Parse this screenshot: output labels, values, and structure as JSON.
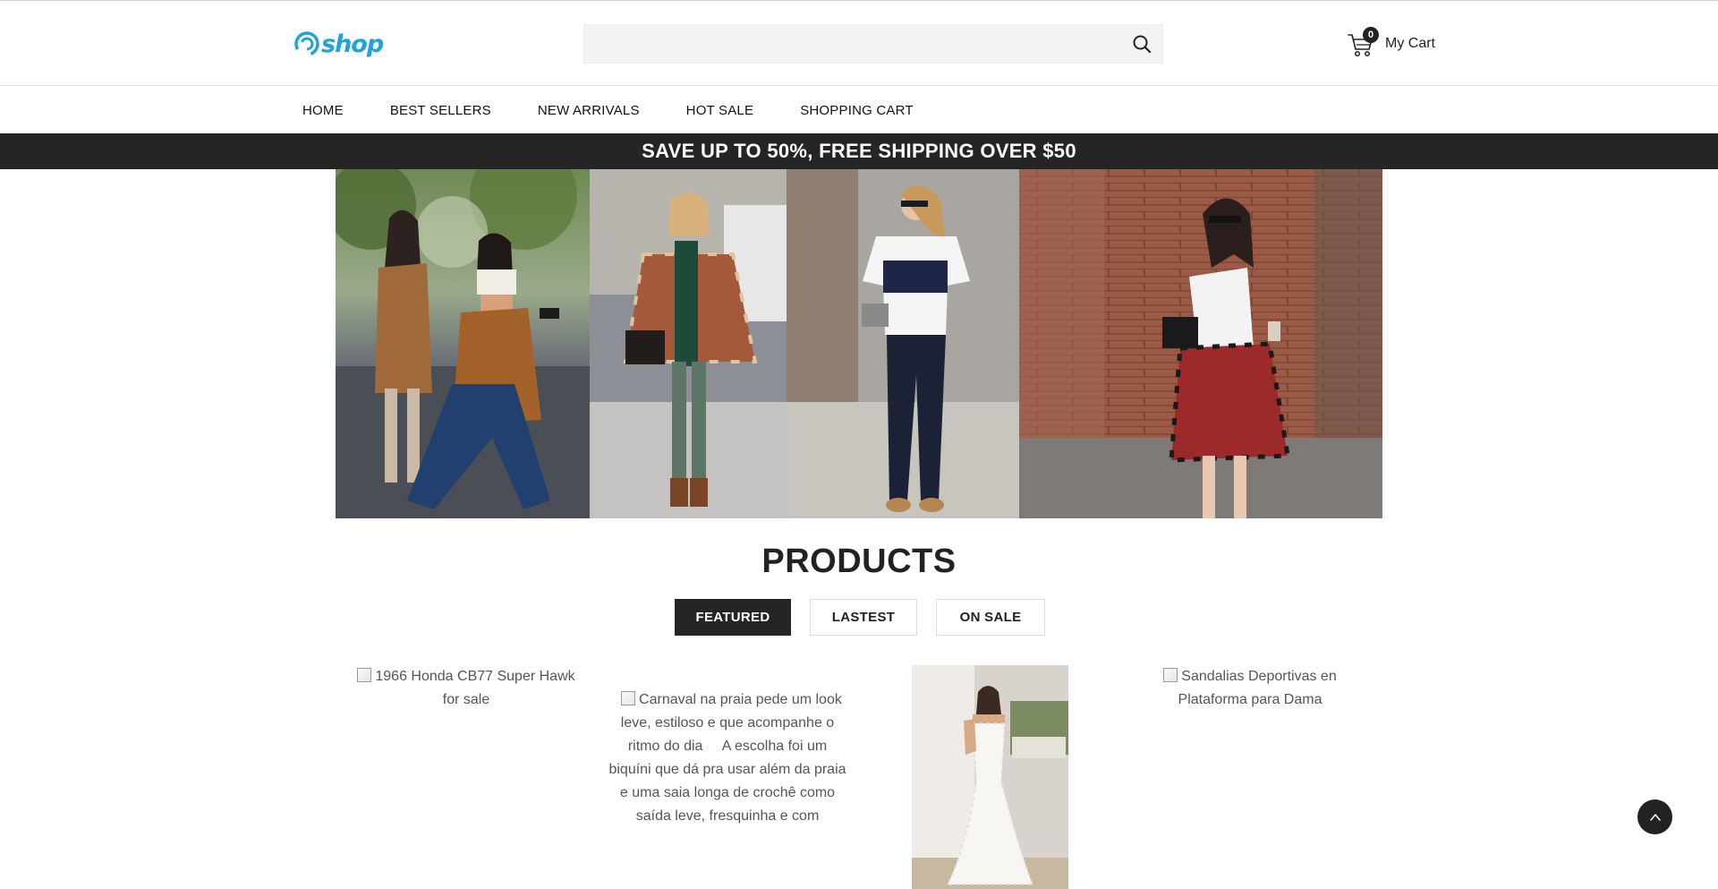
{
  "header": {
    "logo_text": "shop",
    "search": {
      "placeholder": "",
      "value": ""
    },
    "cart": {
      "count": "0",
      "label": "My Cart"
    }
  },
  "nav": {
    "items": [
      {
        "label": "HOME"
      },
      {
        "label": "BEST SELLERS"
      },
      {
        "label": "NEW ARRIVALS"
      },
      {
        "label": "HOT SALE"
      },
      {
        "label": "SHOPPING CART"
      }
    ]
  },
  "promo": {
    "text": "SAVE UP TO 50%, FREE SHIPPING OVER $50"
  },
  "products": {
    "title": "PRODUCTS",
    "tabs": [
      {
        "label": "FEATURED",
        "active": true
      },
      {
        "label": "LASTEST",
        "active": false
      },
      {
        "label": "ON SALE",
        "active": false
      }
    ],
    "items": [
      {
        "alt": "1966 Honda CB77 Super Hawk for sale"
      },
      {
        "alt": "Carnaval na praia pede um look leve, estiloso e que acompanhe o ritmo do dia     A escolha foi um biquíni que dá pra usar além da praia e uma saia longa de crochê como saída leve, fresquinha e com"
      },
      {
        "alt": ""
      },
      {
        "alt": "Sandalias Deportivas en Plataforma para Dama"
      }
    ]
  },
  "colors": {
    "brand": "#1fa3d8",
    "dark": "#252525",
    "search_bg": "#f3f3f3"
  },
  "icons": [
    "logo-swirl-icon",
    "search-icon",
    "cart-icon",
    "chevron-up-icon",
    "broken-image-icon"
  ]
}
